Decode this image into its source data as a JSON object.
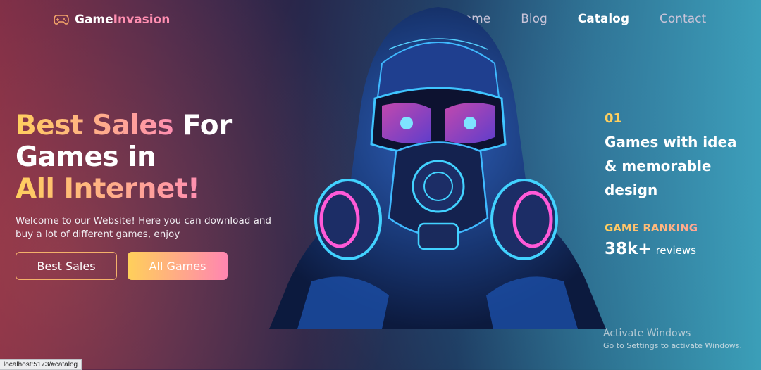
{
  "logo": {
    "part1": "Game",
    "part2": "Invasion",
    "icon": "gamepad-icon"
  },
  "nav": {
    "home": "Home",
    "blog": "Blog",
    "catalog": "Catalog",
    "contact": "Contact"
  },
  "hero": {
    "line1_highlight": "Best Sales",
    "line1_rest": " For",
    "line2": "Games in",
    "line3_highlight": "All Internet!",
    "description": "Welcome to our Website! Here you can download and buy a lot of different games, enjoy",
    "btn_best_sales": "Best Sales",
    "btn_all_games": "All Games",
    "image": "gas-mask-hooded-figure-illustration"
  },
  "stats": {
    "number": "01",
    "headline": "Games with idea & memorable design",
    "ranking_label": "GAME RANKING",
    "ranking_count": "38k+",
    "ranking_unit": "reviews"
  },
  "watermark": {
    "title": "Activate Windows",
    "subtitle": "Go to Settings to activate Windows."
  },
  "status_url": "localhost:5173/#catalog",
  "colors": {
    "accent_yellow": "#ffcf5e",
    "accent_pink": "#ff8fb1",
    "bg_left": "#7a2c46",
    "bg_right": "#3b9fb8"
  }
}
